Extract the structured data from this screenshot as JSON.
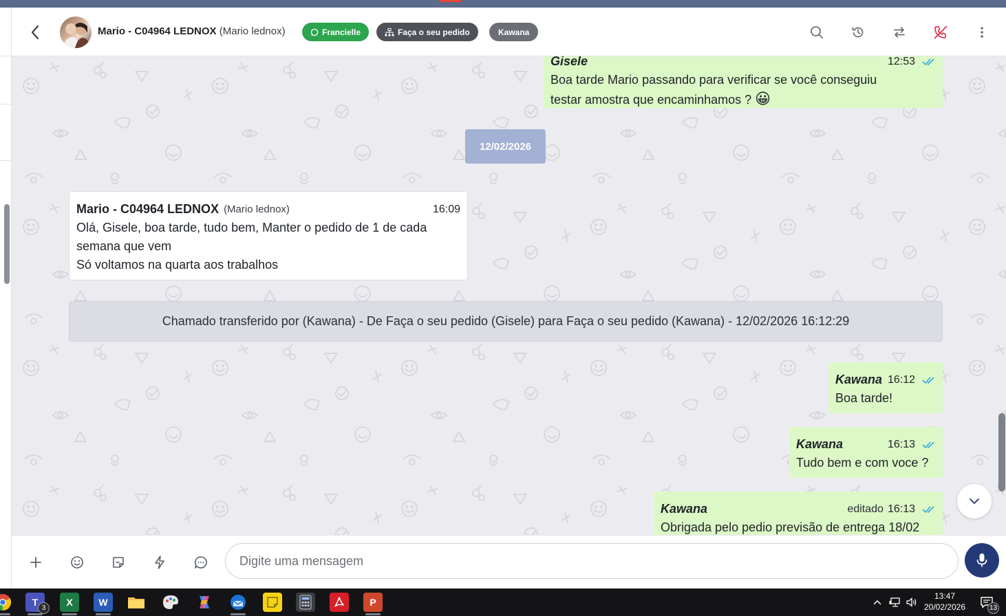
{
  "header": {
    "contact_name": "Mario - C04964 LEDNOX",
    "contact_sub": "(Mario lednox)",
    "tags": [
      "Francielle",
      "Faça o seu pedido",
      "Kawana"
    ]
  },
  "messages": {
    "top": {
      "author": "Gisele",
      "time": "12:53",
      "line1": "Boa tarde Mario passando para verificar se você conseguiu",
      "line2": "testar amostra que encaminhamos ?",
      "emoji": "😀"
    },
    "date_separator": "12/02/2026",
    "incoming": {
      "sender": "Mario - C04964 LEDNOX",
      "sender_sub": "(Mario lednox)",
      "time": "16:09",
      "line1": "Olá, Gisele, boa tarde, tudo bem, Manter o pedido de 1 de cada",
      "line2": "semana que vem",
      "line3": "Só voltamos na quarta aos trabalhos"
    },
    "system": "Chamado transferido por (Kawana) - De Faça o seu pedido (Gisele) para Faça o seu pedido (Kawana) - 12/02/2026 16:12:29",
    "out1": {
      "author": "Kawana",
      "time": "16:12",
      "text": "Boa tarde!"
    },
    "out2": {
      "author": "Kawana",
      "time": "16:13",
      "text": "Tudo bem e com voce ?"
    },
    "out3": {
      "author": "Kawana",
      "edited": "editado",
      "time": "16:13",
      "text": "Obrigada pelo pedio previsão de entrega 18/02"
    }
  },
  "composer": {
    "placeholder": "Digite uma mensagem"
  },
  "taskbar": {
    "teams_badge": "3",
    "time": "13:47",
    "date": "20/02/2026",
    "notif_count": "13"
  },
  "colors": {
    "outgoing_bubble": "#dcf8c6",
    "date_pill": "#a3b1d4",
    "tag_green": "#2da44e",
    "tag_dark": "#4d5158",
    "tag_grey": "#6b6f75",
    "mic_button": "#243a78",
    "ticks": "#34a8e0"
  }
}
